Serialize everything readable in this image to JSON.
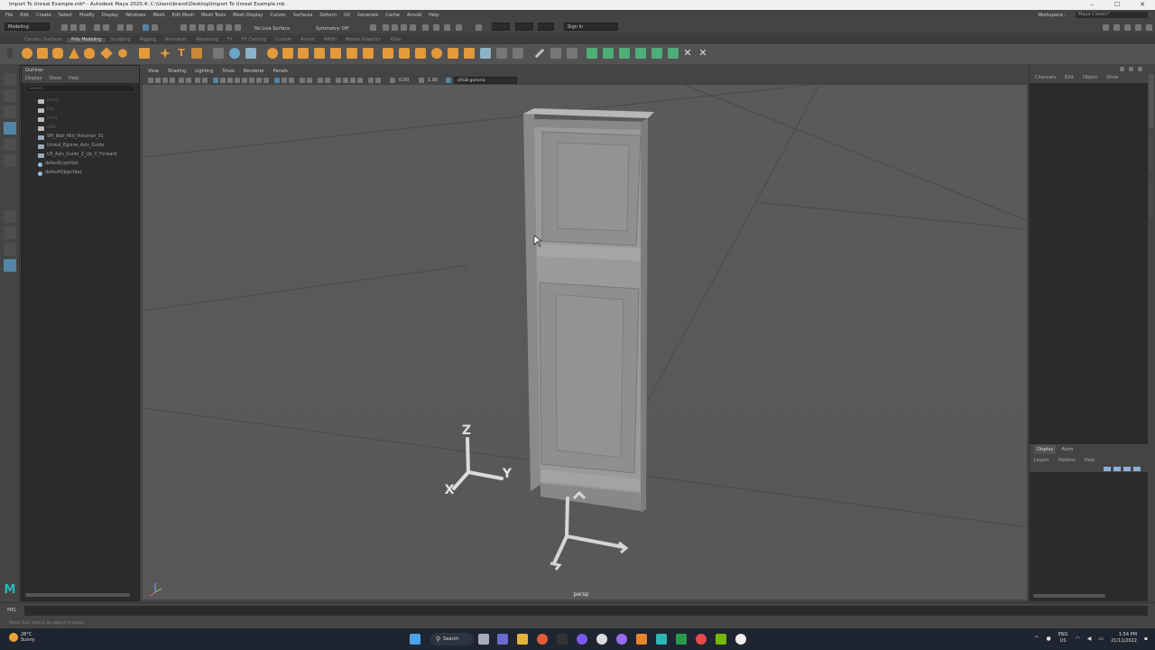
{
  "window": {
    "title": "Import To Unreal Example.mb* - Autodesk Maya 2020.4: C:\\Users\\brand\\Desktop\\Import To Unreal Example.mb",
    "controls": [
      "–",
      "☐",
      "✕"
    ]
  },
  "menubar": {
    "items": [
      "File",
      "Edit",
      "Create",
      "Select",
      "Modify",
      "Display",
      "Windows",
      "Mesh",
      "Edit Mesh",
      "Mesh Tools",
      "Mesh Display",
      "Curves",
      "Surfaces",
      "Deform",
      "UV",
      "Generate",
      "Cache",
      "Arnold",
      "Help"
    ],
    "workspace_label": "Workspace :",
    "workspace_value": "Maya Classic*"
  },
  "statusline": {
    "mode": "Modeling",
    "live_surface": "No Live Surface",
    "symmetry": "Symmetry: Off",
    "signin": "Sign In"
  },
  "shelf": {
    "tabs": [
      "Curves / Surfaces",
      "Poly Modeling",
      "Sculpting",
      "Rigging",
      "Animation",
      "Rendering",
      "FX",
      "FX Caching",
      "Custom",
      "Arnold",
      "MASH",
      "Motion Graphics",
      "XGen"
    ],
    "active_tab": "Poly Modeling"
  },
  "outliner": {
    "title": "Outliner",
    "menu": [
      "Display",
      "Show",
      "Help"
    ],
    "search_placeholder": "Search...",
    "items": [
      {
        "label": "persp",
        "type": "camera",
        "dim": true
      },
      {
        "label": "top",
        "type": "camera",
        "dim": true
      },
      {
        "label": "front",
        "type": "camera",
        "dim": true
      },
      {
        "label": "side",
        "type": "camera",
        "dim": true
      },
      {
        "label": "SM_Wall_Mid_Victorian_01",
        "type": "mesh",
        "dim": false
      },
      {
        "label": "Unreal_Egnine_Axis_Guide",
        "type": "mesh",
        "dim": false
      },
      {
        "label": "UE_Axis_Guide_Z_Up_X_Forward",
        "type": "mesh",
        "dim": false
      },
      {
        "label": "defaultLightSet",
        "type": "set",
        "dim": false
      },
      {
        "label": "defaultObjectSet",
        "type": "set",
        "dim": false
      }
    ]
  },
  "viewport": {
    "menu": [
      "View",
      "Shading",
      "Lighting",
      "Show",
      "Renderer",
      "Panels"
    ],
    "near_value": "0.00",
    "far_value": "1.00",
    "colorspace": "sRGB gamma",
    "camera_label": "persp",
    "axis_labels": {
      "z": "Z",
      "y": "Y",
      "x": "X"
    }
  },
  "channelbox": {
    "menu": [
      "Channels",
      "Edit",
      "Object",
      "Show"
    ]
  },
  "layers": {
    "tabs": [
      "Display",
      "Anim"
    ],
    "menu": [
      "Layers",
      "Options",
      "Help"
    ]
  },
  "commandline": {
    "mel_label": "MEL"
  },
  "helpline": {
    "text": "Move Tool: Select an object to move."
  },
  "taskbar": {
    "temperature": "28°C",
    "weather": "Sunny",
    "search_label": "Search",
    "lang_top": "ENG",
    "lang_bottom": "US",
    "time": "1:54 PM",
    "date": "21/11/2022"
  },
  "colors": {
    "accent_selected": "#5285a6",
    "shelf_icon_orange": "#e39a3c",
    "shelf_icon_green": "#4fae78",
    "viewport_bg": "#585858"
  }
}
